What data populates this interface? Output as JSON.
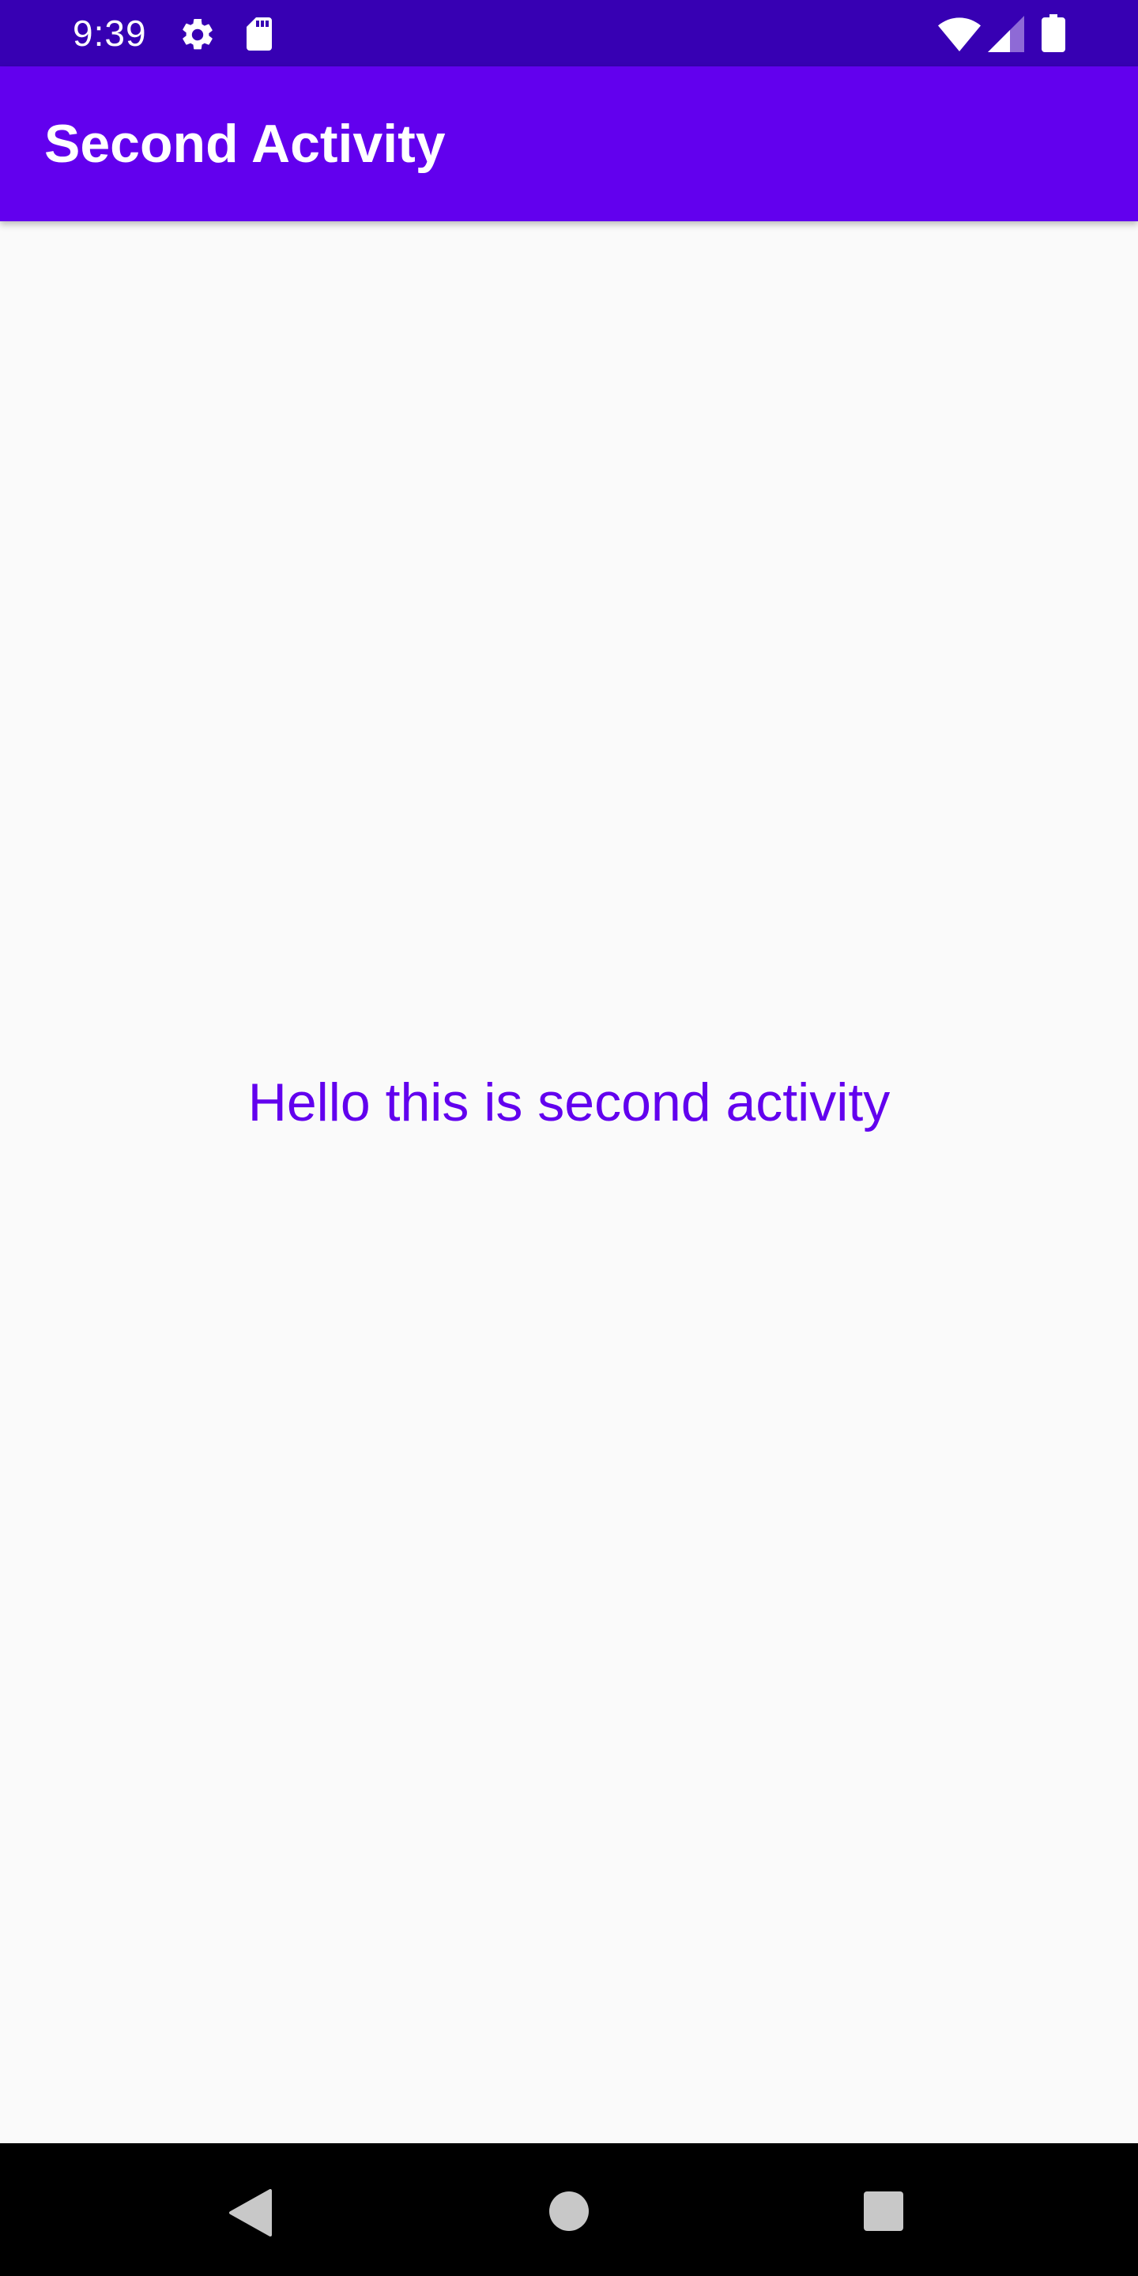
{
  "status_bar": {
    "time": "9:39",
    "left_icons": [
      "gear-icon",
      "sd-card-icon"
    ],
    "right_icons": [
      "wifi-icon",
      "cellular-signal-icon",
      "battery-icon"
    ],
    "background_color": "#3700b3"
  },
  "app_bar": {
    "title": "Second Activity",
    "background_color": "#6200ee"
  },
  "main": {
    "message": "Hello this is second activity",
    "message_color": "#6200ee"
  },
  "nav_bar": {
    "buttons": [
      "back-icon",
      "home-icon",
      "recents-icon"
    ],
    "background_color": "#000000"
  }
}
